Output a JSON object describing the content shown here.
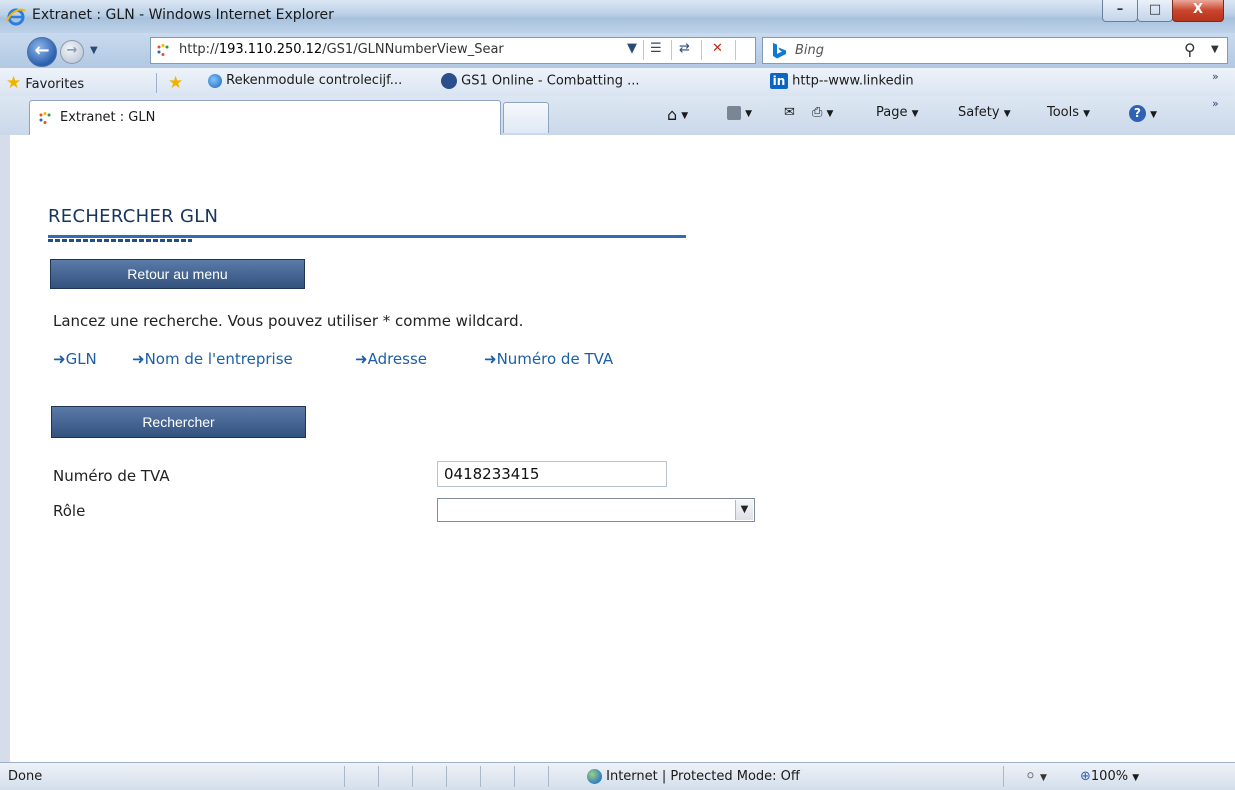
{
  "window": {
    "title": "Extranet : GLN - Windows Internet Explorer",
    "min_label": "–",
    "max_label": "□",
    "close_label": "X"
  },
  "addressbar": {
    "url_prefix": "http://",
    "url_host": "193.110.250.12",
    "url_path": "/GS1/GLNNumberView_Sear",
    "search_placeholder": "Bing"
  },
  "favorites": {
    "label": "Favorites",
    "items": [
      {
        "label": "Rekenmodule controlecijf..."
      },
      {
        "label": "GS1 Online - Combatting ..."
      },
      {
        "label": "http--www.linkedin"
      }
    ]
  },
  "tabs": {
    "active_label": "Extranet : GLN"
  },
  "commandbar": {
    "page": "Page",
    "safety": "Safety",
    "tools": "Tools"
  },
  "page": {
    "title": "RECHERCHER GLN",
    "back_button": "Retour au menu",
    "instructions": "Lancez une recherche. Vous pouvez utiliser * comme wildcard.",
    "criteria": [
      {
        "label": "GLN"
      },
      {
        "label": "Nom de l'entreprise"
      },
      {
        "label": "Adresse"
      },
      {
        "label": "Numéro de TVA"
      }
    ],
    "search_button": "Rechercher",
    "form": {
      "vat_label": "Numéro de TVA",
      "vat_value": "0418233415",
      "role_label": "Rôle",
      "role_value": ""
    }
  },
  "statusbar": {
    "status": "Done",
    "zone": "Internet | Protected Mode: Off",
    "zoom": "100%"
  },
  "colors": {
    "heading": "#17365d",
    "link": "#1b5fa8",
    "button": "#3f5f8c",
    "rule": "#2e6db4"
  }
}
